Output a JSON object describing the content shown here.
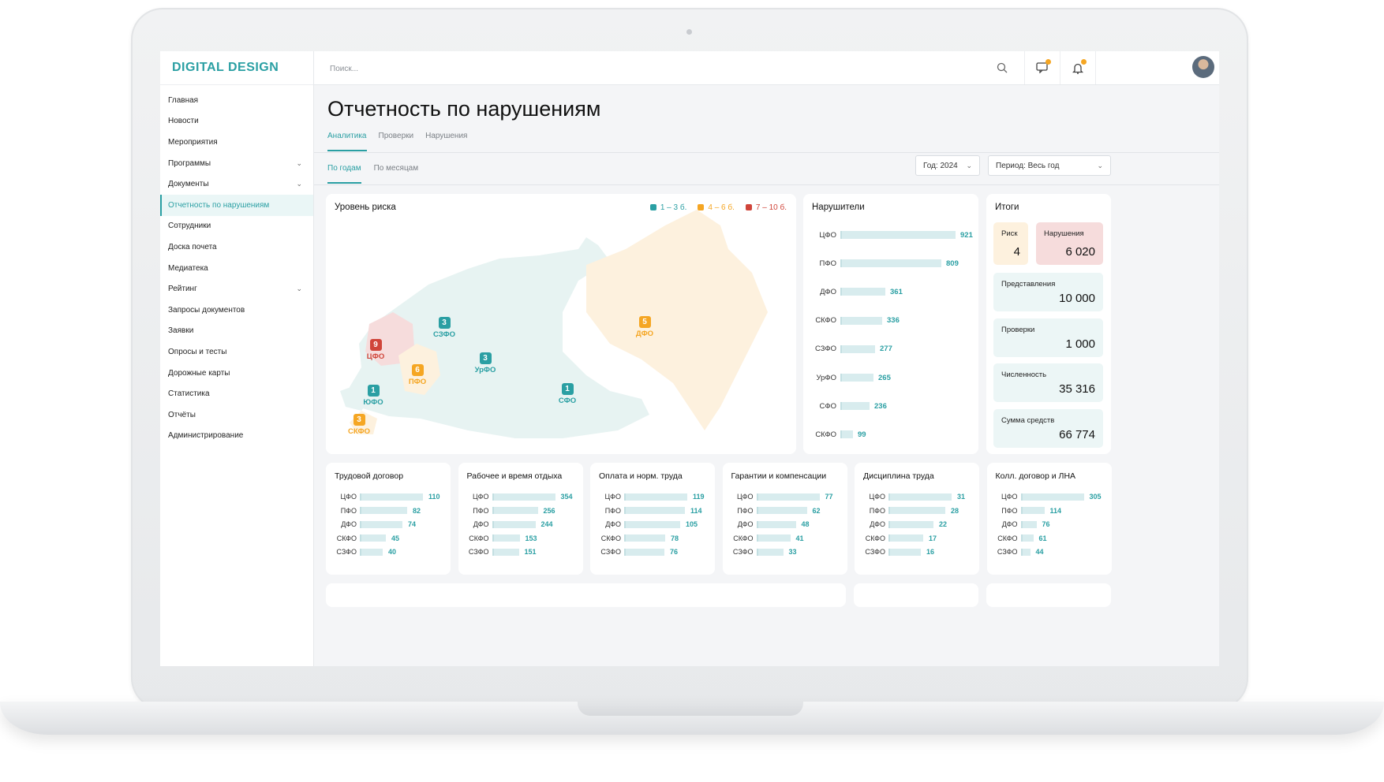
{
  "app": {
    "logo": "DIGITAL DESIGN"
  },
  "search": {
    "placeholder": "Поиск..."
  },
  "sidebar": {
    "items": [
      {
        "label": "Главная",
        "expandable": false
      },
      {
        "label": "Новости",
        "expandable": false
      },
      {
        "label": "Мероприятия",
        "expandable": false
      },
      {
        "label": "Программы",
        "expandable": true
      },
      {
        "label": "Документы",
        "expandable": true
      },
      {
        "label": "Отчетность по нарушениям",
        "expandable": false,
        "active": true
      },
      {
        "label": "Сотрудники",
        "expandable": false
      },
      {
        "label": "Доска почета",
        "expandable": false
      },
      {
        "label": "Медиатека",
        "expandable": false
      },
      {
        "label": "Рейтинг",
        "expandable": true
      },
      {
        "label": "Запросы документов",
        "expandable": false
      },
      {
        "label": "Заявки",
        "expandable": false
      },
      {
        "label": "Опросы и тесты",
        "expandable": false
      },
      {
        "label": "Дорожные карты",
        "expandable": false
      },
      {
        "label": "Статистика",
        "expandable": false
      },
      {
        "label": "Отчёты",
        "expandable": false
      },
      {
        "label": "Администрирование",
        "expandable": false
      }
    ]
  },
  "page": {
    "title": "Отчетность по нарушениям"
  },
  "tabs": [
    "Аналитика",
    "Проверки",
    "Нарушения"
  ],
  "active_tab": 0,
  "subtabs": [
    "По годам",
    "По месяцам"
  ],
  "active_subtab": 0,
  "filters": {
    "year": "Год: 2024",
    "period": "Период: Весь год"
  },
  "colors": {
    "accent": "#2a9fa3",
    "low": "#2a9fa3",
    "mid": "#f5a623",
    "high": "#d0453a"
  },
  "risk_map": {
    "title": "Уровень риска",
    "legend": [
      {
        "label": "1 – 3 б.",
        "color": "#2a9fa3"
      },
      {
        "label": "4 – 6 б.",
        "color": "#f5a623"
      },
      {
        "label": "7 – 10 б.",
        "color": "#d0453a"
      }
    ],
    "regions": [
      {
        "name": "СЗФО",
        "score": "3",
        "level": "low"
      },
      {
        "name": "ЦФО",
        "score": "9",
        "level": "high"
      },
      {
        "name": "ПФО",
        "score": "6",
        "level": "mid"
      },
      {
        "name": "УрФО",
        "score": "3",
        "level": "low"
      },
      {
        "name": "ЮФО",
        "score": "1",
        "level": "low"
      },
      {
        "name": "СКФО",
        "score": "3",
        "level": "mid"
      },
      {
        "name": "СФО",
        "score": "1",
        "level": "low"
      },
      {
        "name": "ДФО",
        "score": "5",
        "level": "mid"
      }
    ]
  },
  "violators": {
    "title": "Нарушители",
    "rows": [
      {
        "label": "ЦФО",
        "value": 921
      },
      {
        "label": "ПФО",
        "value": 809
      },
      {
        "label": "ДФО",
        "value": 361
      },
      {
        "label": "СКФО",
        "value": 336
      },
      {
        "label": "СЗФО",
        "value": 277
      },
      {
        "label": "УрФО",
        "value": 265
      },
      {
        "label": "СФО",
        "value": 236
      },
      {
        "label": "СКФО",
        "value": 99
      }
    ],
    "max": 921
  },
  "totals": {
    "title": "Итоги",
    "risk": {
      "label": "Риск",
      "value": "4"
    },
    "violations": {
      "label": "Нарушения",
      "value": "6 020"
    },
    "items": [
      {
        "label": "Представления",
        "value": "10 000"
      },
      {
        "label": "Проверки",
        "value": "1 000"
      },
      {
        "label": "Численность",
        "value": "35 316"
      },
      {
        "label": "Сумма средств",
        "value": "66 774"
      }
    ]
  },
  "category_cards": [
    {
      "title": "Трудовой договор",
      "rows": [
        {
          "label": "ЦФО",
          "value": 110
        },
        {
          "label": "ПФО",
          "value": 82
        },
        {
          "label": "ДФО",
          "value": 74
        },
        {
          "label": "СКФО",
          "value": 45
        },
        {
          "label": "СЗФО",
          "value": 40
        }
      ]
    },
    {
      "title": "Рабочее и время отдыха",
      "rows": [
        {
          "label": "ЦФО",
          "value": 354
        },
        {
          "label": "ПФО",
          "value": 256
        },
        {
          "label": "ДФО",
          "value": 244
        },
        {
          "label": "СКФО",
          "value": 153
        },
        {
          "label": "СЗФО",
          "value": 151
        }
      ]
    },
    {
      "title": "Оплата и норм. труда",
      "rows": [
        {
          "label": "ЦФО",
          "value": 119
        },
        {
          "label": "ПФО",
          "value": 114
        },
        {
          "label": "ДФО",
          "value": 105
        },
        {
          "label": "СКФО",
          "value": 78
        },
        {
          "label": "СЗФО",
          "value": 76
        }
      ]
    },
    {
      "title": "Гарантии и компенсации",
      "rows": [
        {
          "label": "ЦФО",
          "value": 77
        },
        {
          "label": "ПФО",
          "value": 62
        },
        {
          "label": "ДФО",
          "value": 48
        },
        {
          "label": "СКФО",
          "value": 41
        },
        {
          "label": "СЗФО",
          "value": 33
        }
      ]
    },
    {
      "title": "Дисциплина труда",
      "rows": [
        {
          "label": "ЦФО",
          "value": 31
        },
        {
          "label": "ПФО",
          "value": 28
        },
        {
          "label": "ДФО",
          "value": 22
        },
        {
          "label": "СКФО",
          "value": 17
        },
        {
          "label": "СЗФО",
          "value": 16
        }
      ]
    },
    {
      "title": "Колл. договор и ЛНА",
      "rows": [
        {
          "label": "ЦФО",
          "value": 305
        },
        {
          "label": "ПФО",
          "value": 114
        },
        {
          "label": "ДФО",
          "value": 76
        },
        {
          "label": "СКФО",
          "value": 61
        },
        {
          "label": "СЗФО",
          "value": 44
        }
      ]
    }
  ],
  "icons": {
    "search": "search-icon",
    "messages": "chat-icon",
    "notifications": "bell-icon",
    "chevron": "chevron-down-icon"
  }
}
